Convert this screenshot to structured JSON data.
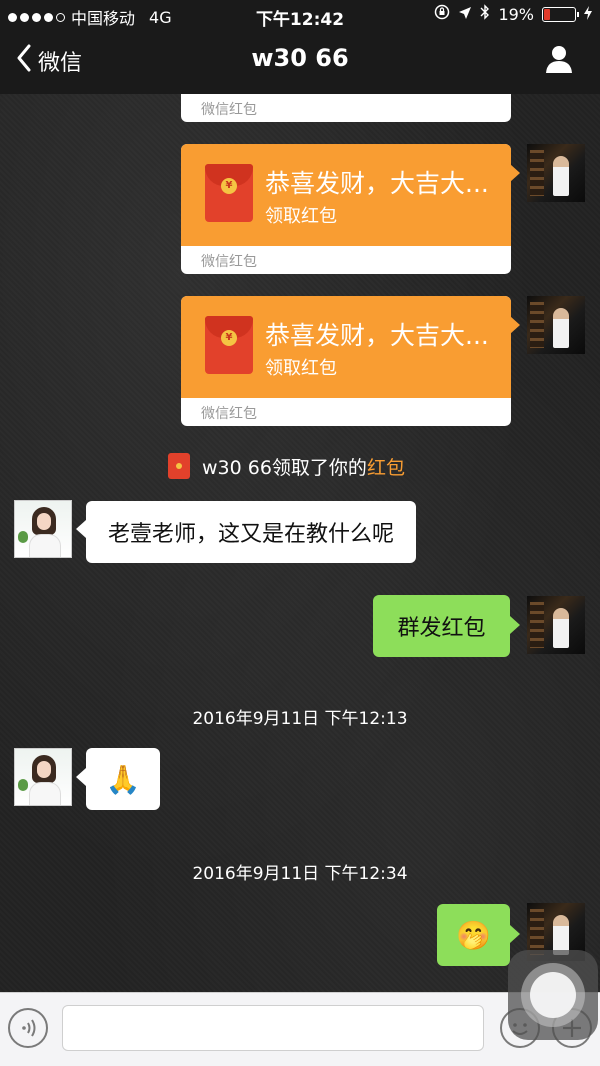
{
  "status_bar": {
    "carrier": "中国移动",
    "network": "4G",
    "time": "下午12:42",
    "battery": "19%"
  },
  "nav": {
    "back_label": "微信",
    "title": "w30 66"
  },
  "messages": {
    "top_partial_footer": "微信红包",
    "red_packet_1": {
      "title": "恭喜发财，大吉大...",
      "action": "领取红包",
      "footer": "微信红包"
    },
    "red_packet_2": {
      "title": "恭喜发财，大吉大...",
      "action": "领取红包",
      "footer": "微信红包"
    },
    "notice": {
      "prefix": "w30 66领取了你的",
      "link": "红包"
    },
    "incoming_1": "老壹老师，这又是在教什么呢",
    "outgoing_1": "群发红包",
    "timestamp_1": "2016年9月11日 下午12:13",
    "incoming_2_emoji": "🙏",
    "timestamp_2": "2016年9月11日 下午12:34",
    "outgoing_2_emoji": "🤭"
  },
  "colors": {
    "red_packet": "#f99d32",
    "sent_bubble": "#8dde5a",
    "highlight": "#f99d32"
  }
}
